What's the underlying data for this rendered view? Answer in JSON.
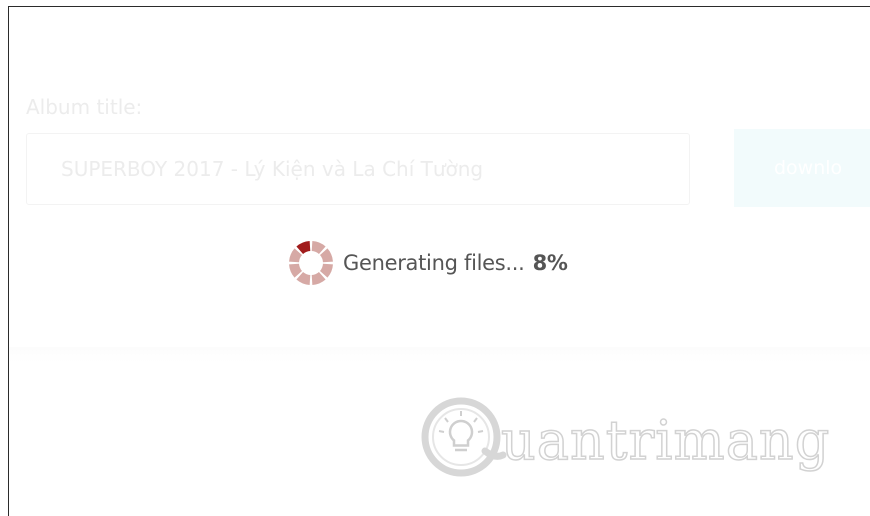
{
  "album": {
    "label": "Album title:",
    "value": "SUPERBOY 2017 - Lý Kiện và La Chí Tường"
  },
  "download_button": {
    "label": "downlo"
  },
  "status": {
    "text": "Generating files...",
    "percent": "8%",
    "progress": 0.08
  },
  "watermark": {
    "text": "uantrimang"
  },
  "colors": {
    "spinner_active": "#a11c1c",
    "spinner_segment": "#d6a9a5",
    "button_bg": "#f2fbfc",
    "faded_text": "#ececec"
  }
}
